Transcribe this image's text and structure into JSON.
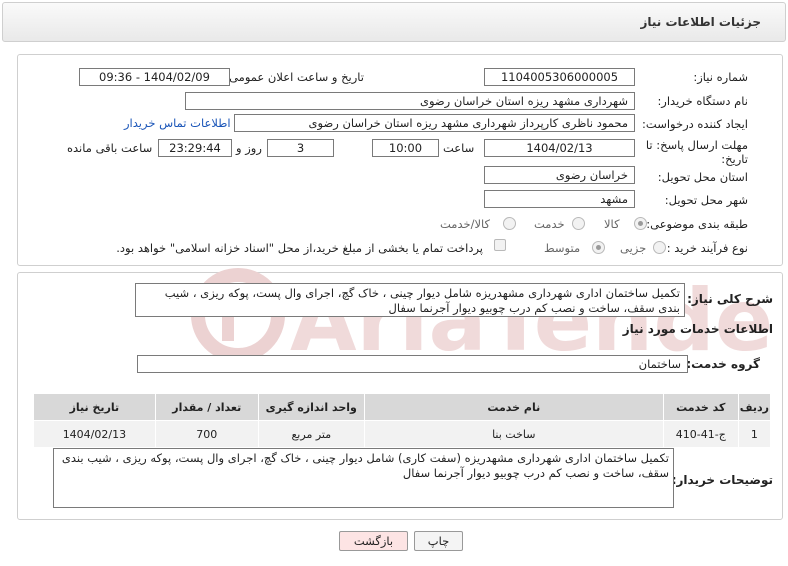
{
  "header": {
    "title": "جزئیات اطلاعات نیاز"
  },
  "form": {
    "need_number_label": "شماره نیاز:",
    "need_number": "1104005306000005",
    "announce_label": "تاریخ و ساعت اعلان عمومی:",
    "announce_value": "1404/02/09 - 09:36",
    "buyer_org_label": "نام دستگاه خریدار:",
    "buyer_org": "شهرداری مشهد ریزه استان خراسان رضوی",
    "requester_label": "ایجاد کننده درخواست:",
    "requester": "محمود ناظری کارپرداز شهرداری مشهد ریزه استان خراسان رضوی",
    "contact_link": "اطلاعات تماس خریدار",
    "deadline_label": "مهلت ارسال پاسخ: تا تاریخ:",
    "deadline_date": "1404/02/13",
    "time_label": "ساعت",
    "deadline_time": "10:00",
    "days_value": "3",
    "days_label": "روز و",
    "remaining_time": "23:29:44",
    "remaining_label": "ساعت باقی مانده",
    "province_label": "استان محل تحویل:",
    "province": "خراسان رضوی",
    "city_label": "شهر محل تحویل:",
    "city": "مشهد",
    "category_label": "طبقه بندی موضوعی:",
    "category_options": [
      "کالا",
      "خدمت",
      "کالا/خدمت"
    ],
    "process_label": "نوع فرآیند خرید :",
    "process_options": [
      "جزیی",
      "متوسط"
    ],
    "payment_note": "پرداخت تمام یا بخشی از مبلغ خرید،از محل \"اسناد خزانه اسلامی\" خواهد بود."
  },
  "summary": {
    "label": "شرح کلی نیاز:",
    "text": "تکمیل ساختمان اداری شهرداری مشهدریزه شامل دیوار چینی ، خاک گچ، اجرای وال پست، پوکه ریزی ، شیب بندی سقف، ساخت و نصب کم درب چوبیو دیوار آجرنما سفال"
  },
  "services": {
    "section_title": "اطلاعات خدمات مورد نیاز",
    "group_label": "گروه خدمت:",
    "group_value": "ساختمان",
    "columns": [
      "ردیف",
      "کد خدمت",
      "نام خدمت",
      "واحد اندازه گیری",
      "تعداد / مقدار",
      "تاریخ نیاز"
    ],
    "rows": [
      [
        "1",
        "ج-41-410",
        "ساخت بنا",
        "متر مربع",
        "700",
        "1404/02/13"
      ]
    ]
  },
  "buyer_notes": {
    "label": "توضیحات خریدار:",
    "text": "تکمیل ساختمان اداری شهرداری مشهدریزه (سفت کاری) شامل دیوار چینی ، خاک گچ، اجرای وال پست، پوکه ریزی ، شیب بندی سقف، ساخت و نصب کم درب چوبیو دیوار آجرنما سفال"
  },
  "buttons": {
    "print": "چاپ",
    "back": "بازگشت"
  },
  "colors": {
    "link": "#1a55b8",
    "back_button": "#fde4e4",
    "header_bg": "#ececec",
    "watermark": "#e8c8c8"
  },
  "watermark": {
    "text": "AriaTender.neT"
  }
}
